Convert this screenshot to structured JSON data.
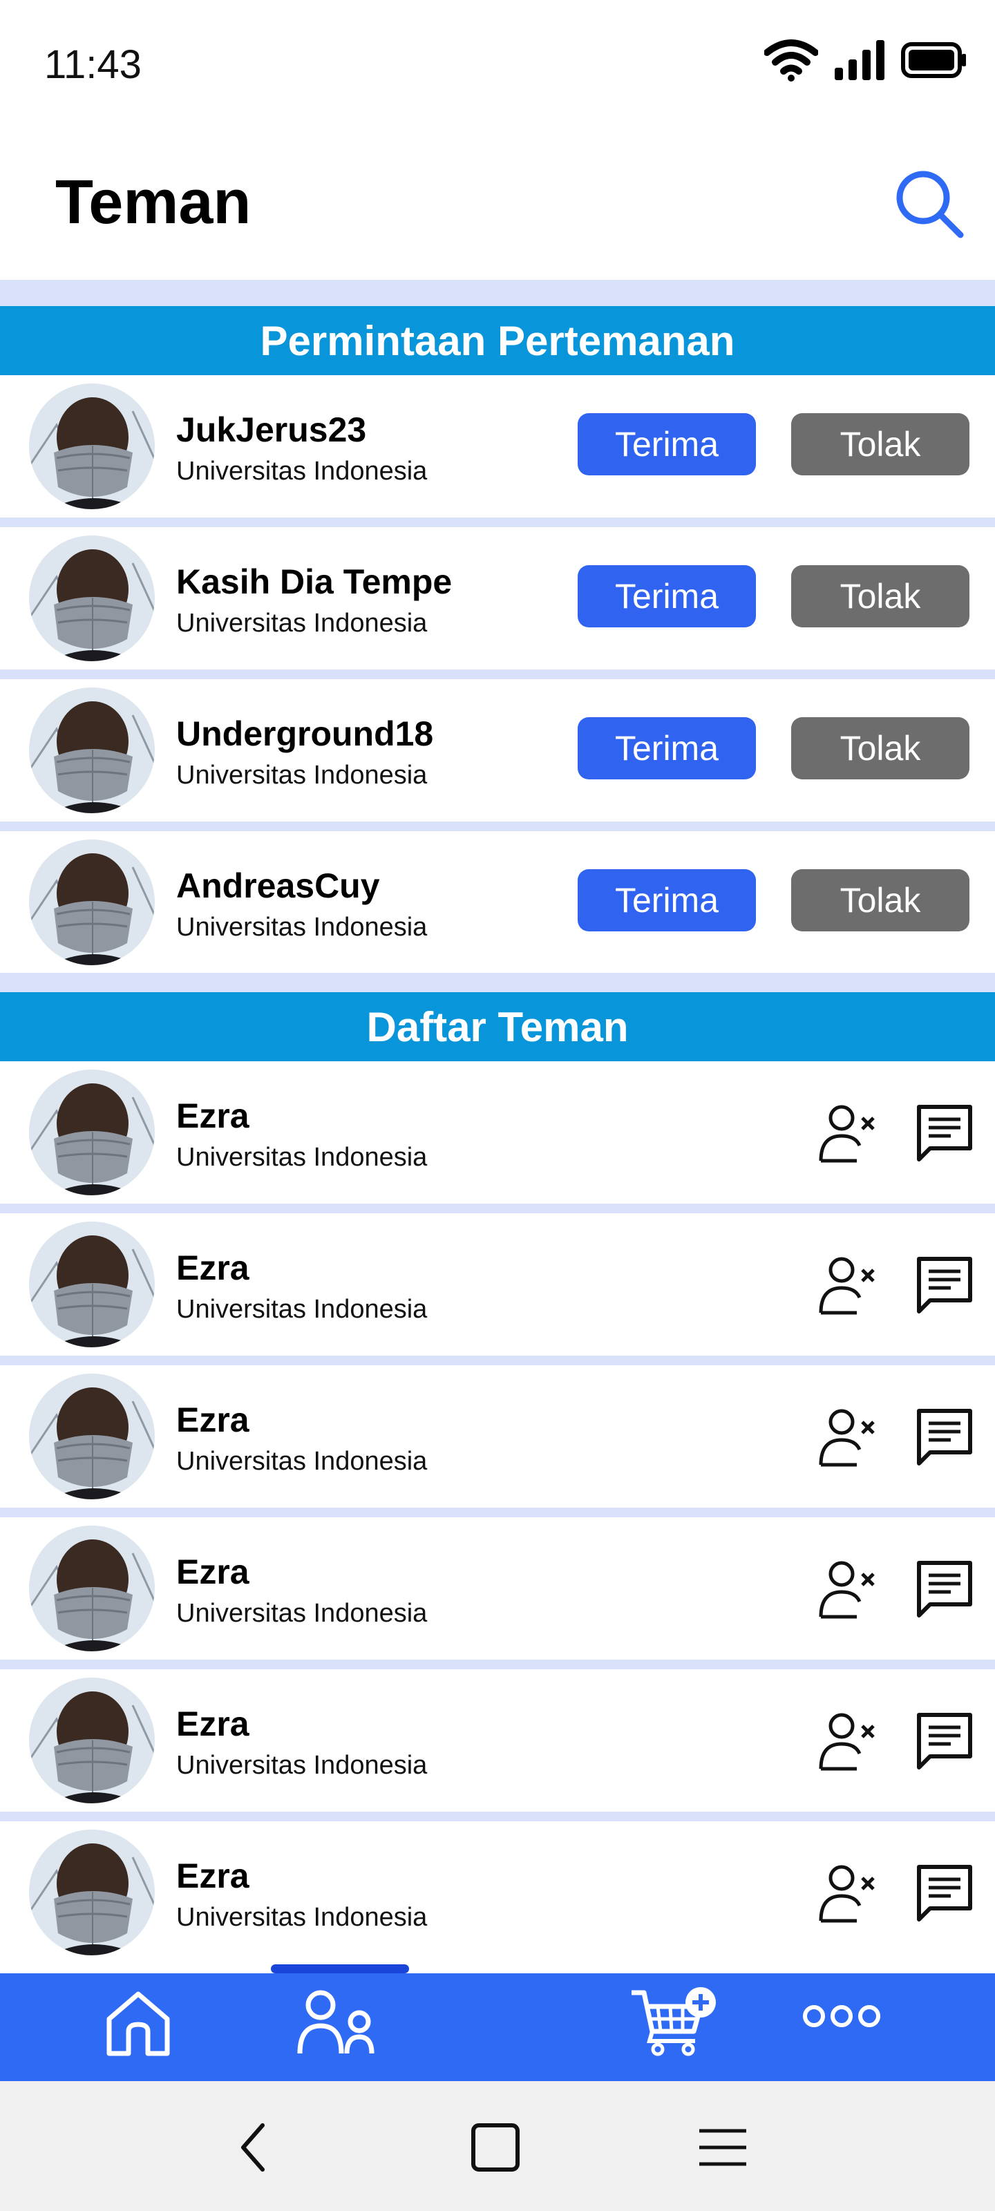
{
  "status_bar": {
    "time": "11:43"
  },
  "header": {
    "title": "Teman"
  },
  "requests_section": {
    "title": "Permintaan Pertemanan",
    "accept_label": "Terima",
    "reject_label": "Tolak",
    "items": [
      {
        "name": "JukJerus23",
        "university": "Universitas Indonesia"
      },
      {
        "name": "Kasih Dia Tempe",
        "university": "Universitas Indonesia"
      },
      {
        "name": "Underground18",
        "university": "Universitas Indonesia"
      },
      {
        "name": "AndreasCuy",
        "university": "Universitas Indonesia"
      }
    ]
  },
  "friends_section": {
    "title": "Daftar Teman",
    "items": [
      {
        "name": "Ezra",
        "university": "Universitas Indonesia"
      },
      {
        "name": "Ezra",
        "university": "Universitas Indonesia"
      },
      {
        "name": "Ezra",
        "university": "Universitas Indonesia"
      },
      {
        "name": "Ezra",
        "university": "Universitas Indonesia"
      },
      {
        "name": "Ezra",
        "university": "Universitas Indonesia"
      },
      {
        "name": "Ezra",
        "university": "Universitas Indonesia"
      }
    ]
  },
  "bottom_nav": {
    "items": [
      {
        "icon": "home-icon"
      },
      {
        "icon": "friends-icon",
        "active": true
      },
      {
        "icon": "cart-add-icon"
      },
      {
        "icon": "more-icon"
      }
    ]
  },
  "colors": {
    "section_header": "#0895d9",
    "accept": "#3063f0",
    "reject": "#6d6d6d",
    "nav": "#2f6af5",
    "separator": "#d9e1fb"
  }
}
